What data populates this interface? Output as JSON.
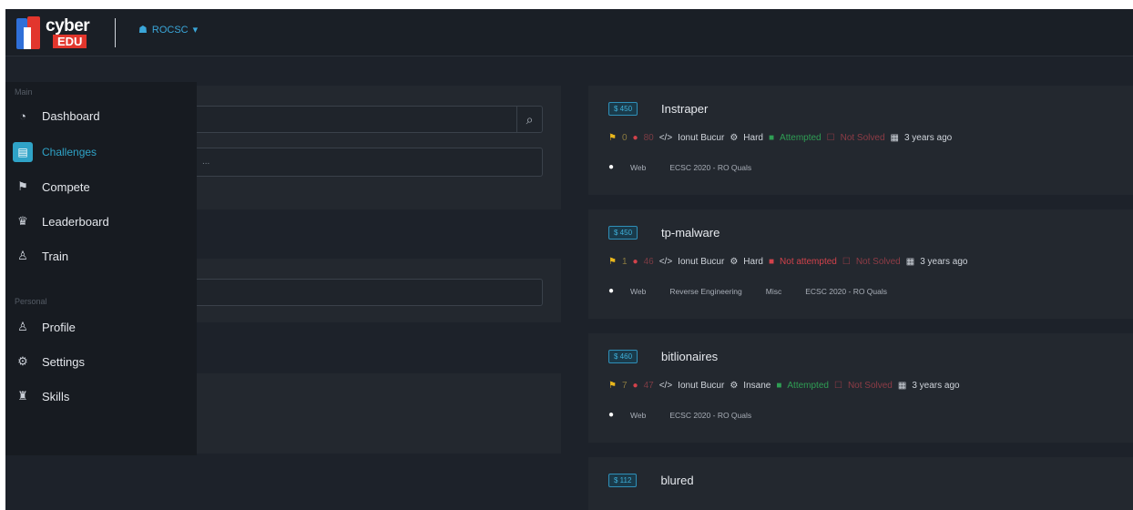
{
  "brand": {
    "top": "cyber",
    "bottom": "EDU"
  },
  "org": {
    "icon": "group-icon",
    "label": "ROCSC",
    "caret": "▾"
  },
  "sidebar": {
    "main_label": "Main",
    "personal_label": "Personal",
    "items": [
      {
        "label": "Dashboard",
        "icon": "gauge-icon",
        "glyph": "◔"
      },
      {
        "label": "Challenges",
        "icon": "challenges-icon",
        "glyph": "▤"
      },
      {
        "label": "Compete",
        "icon": "flag-icon",
        "glyph": "⚑"
      },
      {
        "label": "Leaderboard",
        "icon": "trophy-icon",
        "glyph": "♛"
      },
      {
        "label": "Train",
        "icon": "train-icon",
        "glyph": "♙"
      }
    ],
    "personal": [
      {
        "label": "Profile",
        "icon": "user-icon",
        "glyph": "♙"
      },
      {
        "label": "Settings",
        "icon": "settings-icon",
        "glyph": "⚙"
      },
      {
        "label": "Skills",
        "icon": "skills-icon",
        "glyph": "♜"
      }
    ]
  },
  "filters": {
    "search_icon": "⌕",
    "select_value": "..."
  },
  "challenges": [
    {
      "points": "$ 450",
      "title": "Instraper",
      "flags": "0",
      "solves": "80",
      "author": "Ionut Bucur",
      "difficulty": "Hard",
      "attempted": "Attempted",
      "solved": "Not Solved",
      "time": "3 years ago",
      "tags": [
        "Web",
        "ECSC 2020 - RO Quals"
      ]
    },
    {
      "points": "$ 450",
      "title": "tp-malware",
      "flags": "1",
      "solves": "46",
      "author": "Ionut Bucur",
      "difficulty": "Hard",
      "attempted": "Not attempted",
      "solved": "Not Solved",
      "time": "3 years ago",
      "tags": [
        "Web",
        "Reverse Engineering",
        "Misc",
        "ECSC 2020 - RO Quals"
      ]
    },
    {
      "points": "$ 460",
      "title": "bitlionaires",
      "flags": "7",
      "solves": "47",
      "author": "Ionut Bucur",
      "difficulty": "Insane",
      "attempted": "Attempted",
      "solved": "Not Solved",
      "time": "3 years ago",
      "tags": [
        "Web",
        "ECSC 2020 - RO Quals"
      ]
    },
    {
      "points": "$ 112",
      "title": "blured",
      "flags": "",
      "solves": "",
      "author": "",
      "difficulty": "",
      "attempted": "",
      "solved": "",
      "time": "",
      "tags": []
    }
  ]
}
